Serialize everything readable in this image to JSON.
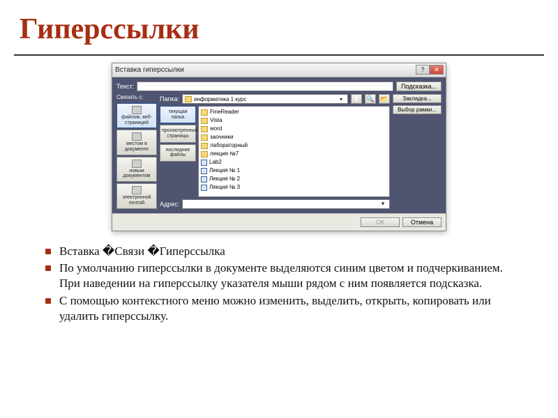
{
  "title": "Гиперссылки",
  "dialog": {
    "caption": "Вставка гиперссылки",
    "link_to_label": "Связать с:",
    "text_label": "Текст:",
    "text_value": "",
    "screentip_btn": "Подсказка...",
    "link_types": {
      "file_web": "файлом, веб-страницей",
      "place_doc": "местом в документе",
      "new_doc": "новым документом",
      "email": "электронной почтой"
    },
    "folder_label": "Папка:",
    "folder_value": "информатика 1 курс",
    "view_tabs": {
      "current": "текущая папка",
      "browsed": "просмотренные страницы",
      "recent": "последние файлы"
    },
    "files": [
      {
        "icon": "folder",
        "name": "FineReader"
      },
      {
        "icon": "folder",
        "name": "Vista"
      },
      {
        "icon": "folder",
        "name": "word"
      },
      {
        "icon": "folder",
        "name": "заочники"
      },
      {
        "icon": "folder",
        "name": "лабораторный"
      },
      {
        "icon": "folder",
        "name": "лекция №7"
      },
      {
        "icon": "doc",
        "name": "Lab2"
      },
      {
        "icon": "doc",
        "name": "Лекция № 1"
      },
      {
        "icon": "doc",
        "name": "Лекция № 2"
      },
      {
        "icon": "doc",
        "name": "Лекция № 3"
      }
    ],
    "bookmark_btn": "Закладка...",
    "target_frame_btn": "Выбор рамки...",
    "address_label": "Адрес:",
    "address_value": "",
    "ok_btn": "ОК",
    "cancel_btn": "Отмена"
  },
  "bullets": [
    "Вставка �Связи �Гиперссылка",
    "По умолчанию гиперссылки в документе выделяются синим цветом и подчеркиванием. При наведении на гиперссылку указателя мыши рядом с ним появляется подсказка.",
    "С помощью контекстного меню можно изменить, выделить, открыть, копировать или удалить гиперссылку."
  ]
}
